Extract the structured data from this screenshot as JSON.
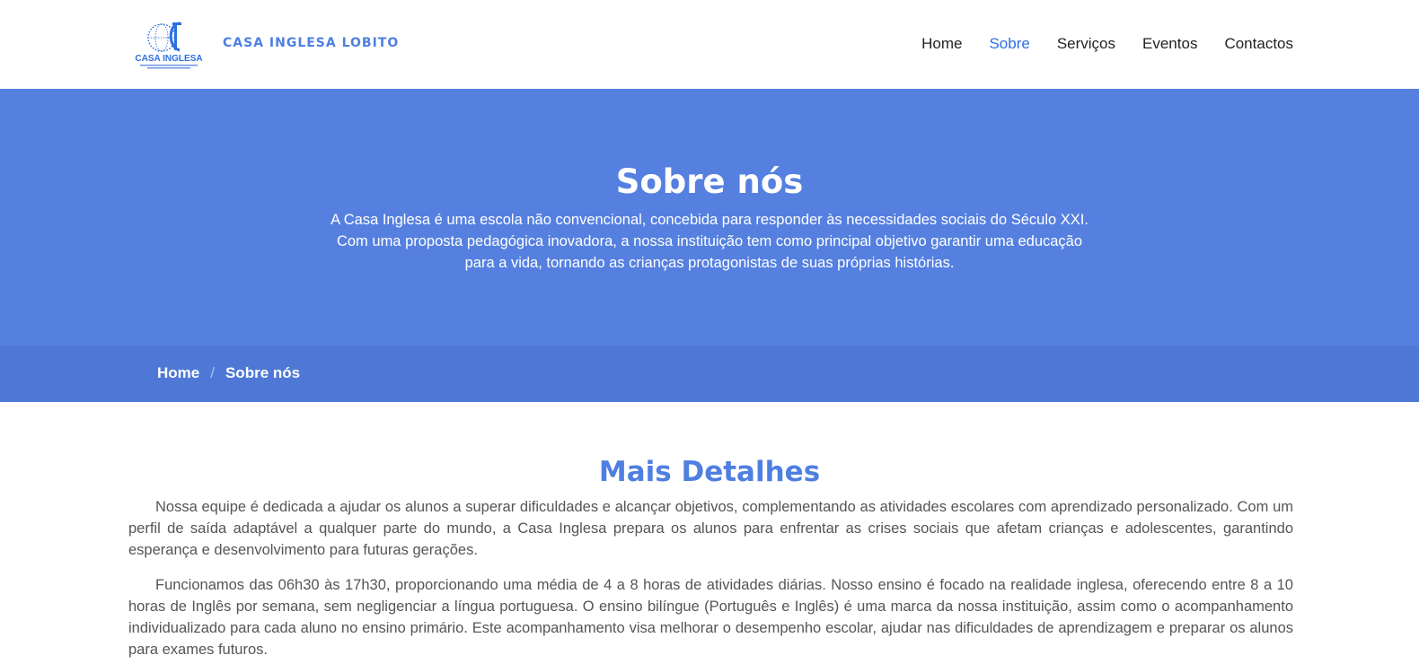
{
  "header": {
    "logo": {
      "icon": "casa-inglesa-logo",
      "text": "CASA INGLESA",
      "color": "#2d6fe0"
    },
    "brand": "CASA INGLESA LOBITO",
    "nav": [
      {
        "label": "Home",
        "active": false
      },
      {
        "label": "Sobre",
        "active": true
      },
      {
        "label": "Serviços",
        "active": false
      },
      {
        "label": "Eventos",
        "active": false
      },
      {
        "label": "Contactos",
        "active": false
      }
    ]
  },
  "hero": {
    "title": "Sobre nós",
    "text_lines": [
      "A Casa Inglesa é uma escola não convencional, concebida para responder às necessidades sociais do Século XXI.",
      "Com uma proposta pedagógica inovadora, a nossa instituição tem como principal objetivo garantir uma educação",
      "para a vida, tornando as crianças protagonistas de suas próprias histórias."
    ],
    "background": "#5580e0"
  },
  "breadcrumb": {
    "items": [
      "Home",
      "Sobre nós"
    ],
    "separator": "/"
  },
  "main": {
    "title": "Mais Detalhes",
    "paragraphs": [
      "Nossa equipe é dedicada a ajudar os alunos a superar dificuldades e alcançar objetivos, complementando as atividades escolares com aprendizado personalizado. Com um perfil de saída adaptável a qualquer parte do mundo, a Casa Inglesa prepara os alunos para enfrentar as crises sociais que afetam crianças e adolescentes, garantindo esperança e desenvolvimento para futuras gerações.",
      "Funcionamos das 06h30 às 17h30, proporcionando uma média de 4 a 8 horas de atividades diárias. Nosso ensino é focado na realidade inglesa, oferecendo entre 8 a 10 horas de Inglês por semana, sem negligenciar a língua portuguesa. O ensino bilíngue (Português e Inglês) é uma marca da nossa instituição, assim como o acompanhamento individualizado para cada aluno no ensino primário. Este acompanhamento visa melhorar o desempenho escolar, ajudar nas dificuldades de aprendizagem e preparar os alunos para exames futuros."
    ]
  }
}
